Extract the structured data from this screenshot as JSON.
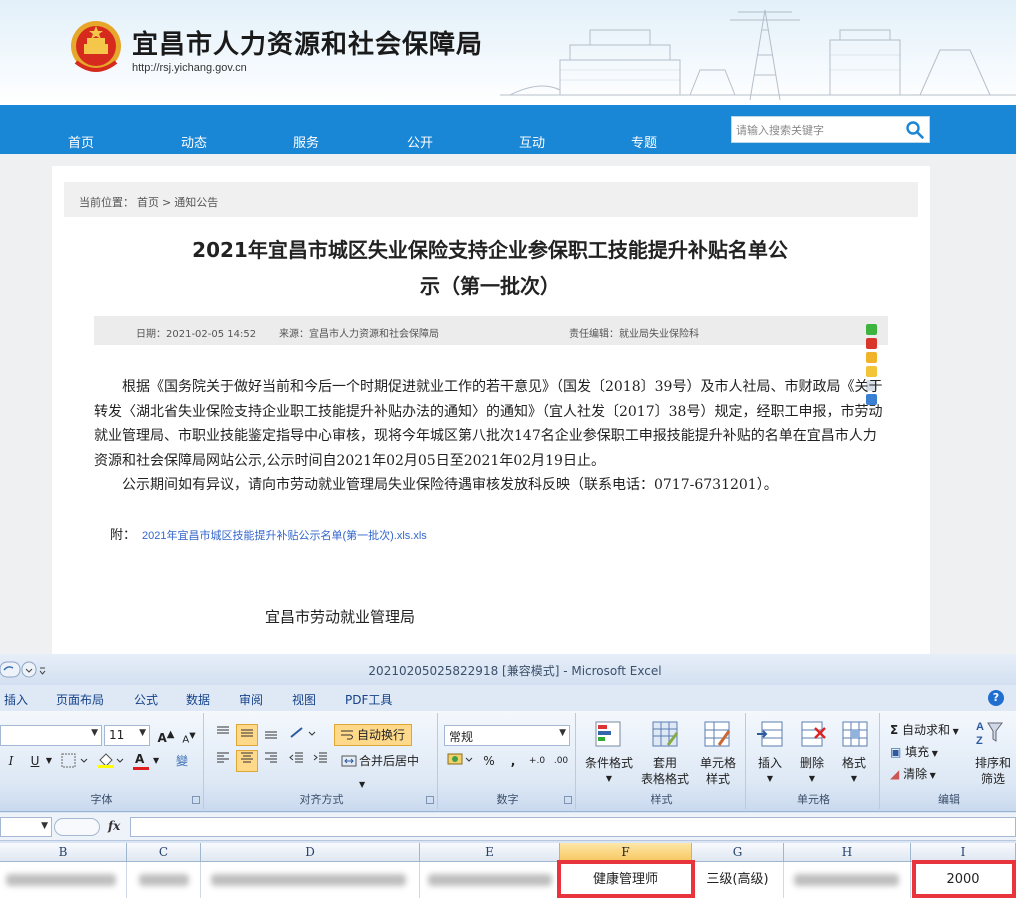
{
  "site": {
    "title": "宜昌市人力资源和社会保障局",
    "url": "http://rsj.yichang.gov.cn",
    "nav": [
      "首页",
      "动态",
      "服务",
      "公开",
      "互动",
      "专题"
    ],
    "search_placeholder": "请输入搜索关键字"
  },
  "article": {
    "breadcrumb": [
      "当前位置：",
      "首页",
      ">",
      "通知公告"
    ],
    "title_lines": [
      "2021年宜昌市城区失业保险支持企业参保职工技能提升补贴名单公",
      "示（第一批次）"
    ],
    "date": "日期：2021-02-05 14:52",
    "source": "来源：宜昌市人力资源和社会保障局",
    "editor": "责任编辑：就业局失业保险科",
    "paragraph1": "根据《国务院关于做好当前和今后一个时期促进就业工作的若干意见》（国发〔2018〕39号）及市人社局、市财政局《关于转发〈湖北省失业保险支持企业职工技能提升补贴办法的通知〉的通知》（宜人社发〔2017〕38号）规定，经职工申报，市劳动就业管理局、市职业技能鉴定指导中心审核，现将今年城区第八批次147名企业参保职工申报技能提升补贴的名单在宜昌市人力资源和社会保障局网站公示,公示时间自2021年02月05日至2021年02月19日止。",
    "paragraph2": "公示期间如有异议，请向市劳动就业管理局失业保险待遇审核发放科反映（联系电话：0717-6731201）。",
    "attach_label": "附：",
    "attach_link": "2021年宜昌市城区技能提升补贴公示名单(第一批次).xls.xls",
    "signature": "宜昌市劳动就业管理局"
  },
  "excel": {
    "window_title": "20210205025822918 [兼容模式] - Microsoft Excel",
    "menu": [
      "插入",
      "页面布局",
      "公式",
      "数据",
      "审阅",
      "视图",
      "PDF工具"
    ],
    "help": "?",
    "ribbon": {
      "font": {
        "size": "11",
        "grow": "A",
        "shrink": "A",
        "italic": "I",
        "underline": "U",
        "fill": "A",
        "wen": "變",
        "label": "字体"
      },
      "align": {
        "wrap": "自动换行",
        "merge": "合并后居中",
        "label": "对齐方式"
      },
      "number": {
        "format": "常规",
        "pct": "%",
        "comma": ",",
        "inc": "+.0",
        "dec": ".00",
        "label": "数字"
      },
      "styles": {
        "cond": "条件格式",
        "table1": "套用",
        "table2": "表格格式",
        "cell1": "单元格",
        "cell2": "样式",
        "label": "样式"
      },
      "cells": {
        "insert": "插入",
        "delete": "删除",
        "format": "格式",
        "label": "单元格"
      },
      "edit": {
        "autosum": "自动求和",
        "fill": "填充",
        "clear": "清除",
        "sort1": "排序和",
        "sort2": "筛选",
        "sigma": "Σ",
        "label": "编辑"
      }
    },
    "fx": "fx",
    "columns": [
      "B",
      "C",
      "D",
      "E",
      "F",
      "G",
      "H",
      "I"
    ],
    "row": {
      "f": "健康管理师",
      "g": "三级(高级)",
      "i": "2000"
    },
    "colors": {
      "highlight": "#e8343c",
      "nav": "#1a86d6"
    }
  }
}
